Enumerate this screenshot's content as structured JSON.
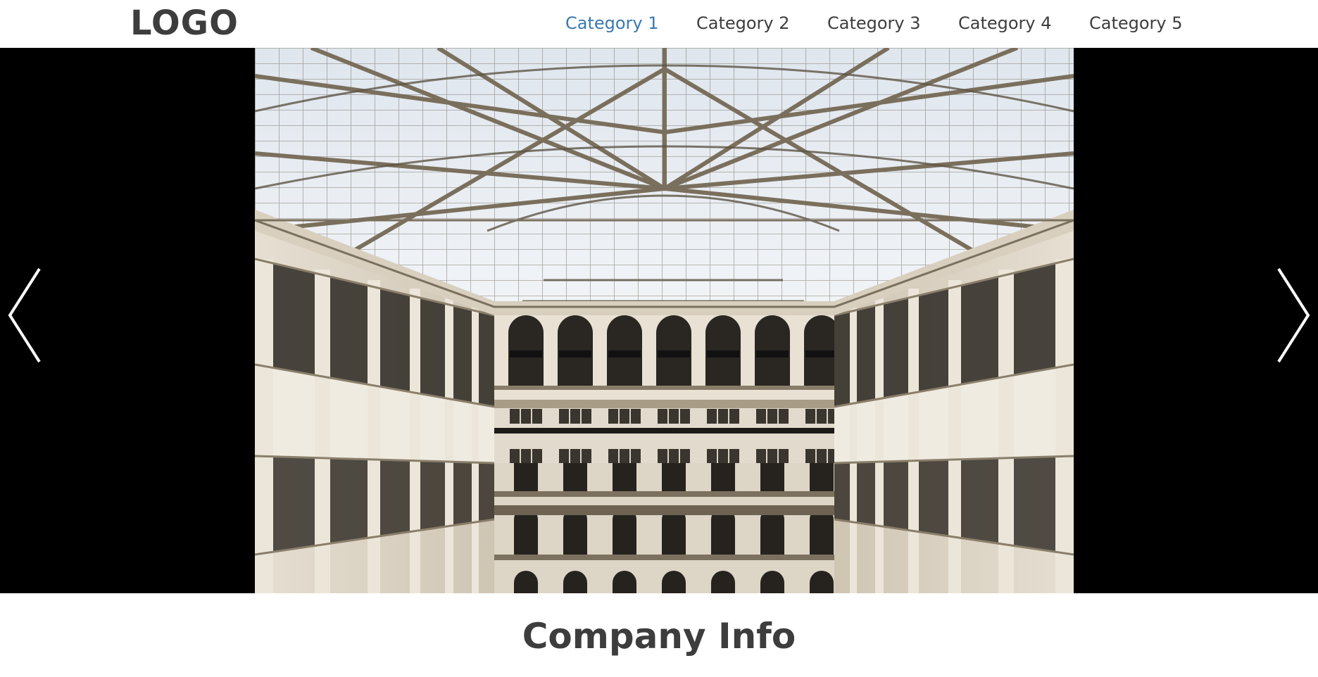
{
  "header": {
    "logo": "LOGO",
    "nav": [
      {
        "label": "Category 1",
        "active": true
      },
      {
        "label": "Category 2",
        "active": false
      },
      {
        "label": "Category 3",
        "active": false
      },
      {
        "label": "Category 4",
        "active": false
      },
      {
        "label": "Category 5",
        "active": false
      }
    ]
  },
  "carousel": {
    "slide_image": "atrium-skylight-photo",
    "prev_icon": "chevron-left-icon",
    "next_icon": "chevron-right-icon"
  },
  "main": {
    "section_title": "Company Info"
  },
  "colors": {
    "text": "#3d3d3d",
    "active_link": "#3a78ae",
    "carousel_bg": "#000000"
  }
}
